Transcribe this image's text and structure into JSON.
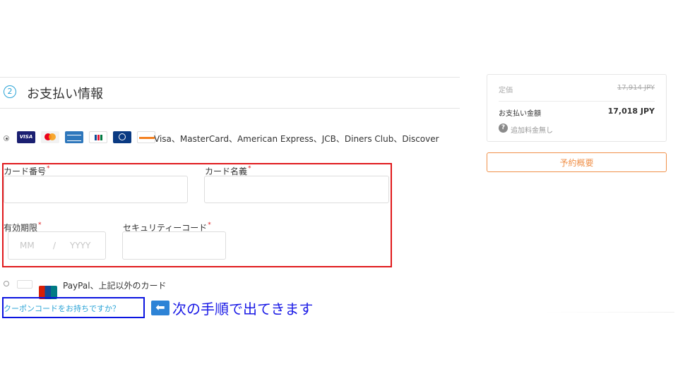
{
  "payment_section": {
    "step_number": "2",
    "title": "お支払い情報"
  },
  "card_method": {
    "logos": {
      "visa": "VISA"
    },
    "brands_text": "Visa、MasterCard、American Express、JCB、Diners Club、Discover",
    "fields": {
      "card_number": {
        "label": "カード番号",
        "required": "*",
        "value": ""
      },
      "card_name": {
        "label": "カード名義",
        "required": "*",
        "value": ""
      },
      "expiry": {
        "label": "有効期限",
        "required": "*",
        "month_placeholder": "MM",
        "separator": "/",
        "year_placeholder": "YYYY"
      },
      "security_code": {
        "label": "セキュリティーコード",
        "required": "*",
        "value": ""
      }
    }
  },
  "other_method": {
    "text": "PayPal、上記以外のカード"
  },
  "coupon": {
    "link_text": "クーポンコードをお持ちですか？"
  },
  "annotation": {
    "arrow": "⬅",
    "text": "次の手順で出てきます"
  },
  "summary": {
    "list_price_label": "定価",
    "list_price": "17,914 JPY",
    "total_label": "お支払い金額",
    "total": "17,018 JPY",
    "help_icon": "?",
    "note": "追加料金無し"
  },
  "overview_button": {
    "label": "予約概要"
  },
  "colors": {
    "accent_blue": "#29a3d6",
    "orange": "#f0914a",
    "red_highlight": "#e0191c",
    "blue_highlight": "#0b15e0",
    "annotation_text": "#1a1ae6"
  }
}
